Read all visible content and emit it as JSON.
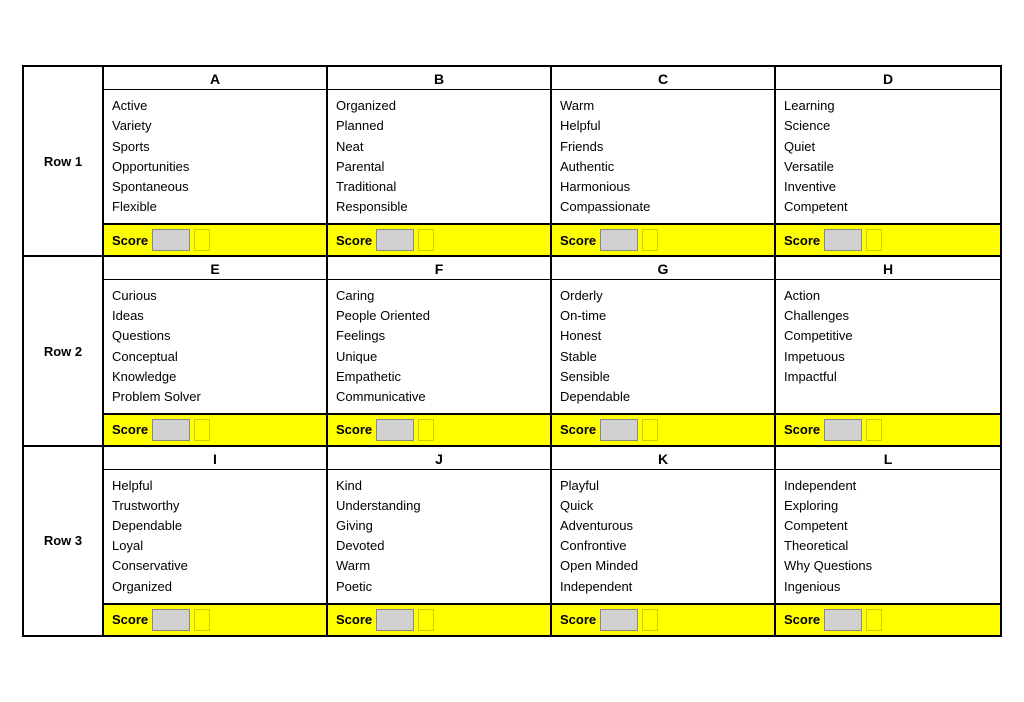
{
  "rows": [
    {
      "label": "Row 1",
      "cells": [
        {
          "header": "A",
          "items": [
            "Active",
            "Variety",
            "Sports",
            "Opportunities",
            "Spontaneous",
            "Flexible"
          ]
        },
        {
          "header": "B",
          "items": [
            "Organized",
            "Planned",
            "Neat",
            "Parental",
            "Traditional",
            "Responsible"
          ]
        },
        {
          "header": "C",
          "items": [
            "Warm",
            "Helpful",
            "Friends",
            "Authentic",
            "Harmonious",
            "Compassionate"
          ]
        },
        {
          "header": "D",
          "items": [
            "Learning",
            "Science",
            "Quiet",
            "Versatile",
            "Inventive",
            "Competent"
          ]
        }
      ]
    },
    {
      "label": "Row 2",
      "cells": [
        {
          "header": "E",
          "items": [
            "Curious",
            "Ideas",
            "Questions",
            "Conceptual",
            "Knowledge",
            "Problem Solver"
          ]
        },
        {
          "header": "F",
          "items": [
            "Caring",
            "People Oriented",
            "Feelings",
            "Unique",
            "Empathetic",
            "Communicative"
          ]
        },
        {
          "header": "G",
          "items": [
            "Orderly",
            "On-time",
            "Honest",
            "Stable",
            "Sensible",
            "Dependable"
          ]
        },
        {
          "header": "H",
          "items": [
            "Action",
            "Challenges",
            "Competitive",
            "Impetuous",
            "Impactful"
          ]
        }
      ]
    },
    {
      "label": "Row 3",
      "cells": [
        {
          "header": "I",
          "items": [
            "Helpful",
            "Trustworthy",
            "Dependable",
            "Loyal",
            "Conservative",
            "Organized"
          ]
        },
        {
          "header": "J",
          "items": [
            "Kind",
            "Understanding",
            "Giving",
            "Devoted",
            "Warm",
            "Poetic"
          ]
        },
        {
          "header": "K",
          "items": [
            "Playful",
            "Quick",
            "Adventurous",
            "Confrontive",
            "Open Minded",
            "Independent"
          ]
        },
        {
          "header": "L",
          "items": [
            "Independent",
            "Exploring",
            "Competent",
            "Theoretical",
            "Why Questions",
            "Ingenious"
          ]
        }
      ]
    }
  ],
  "score_label": "Score"
}
